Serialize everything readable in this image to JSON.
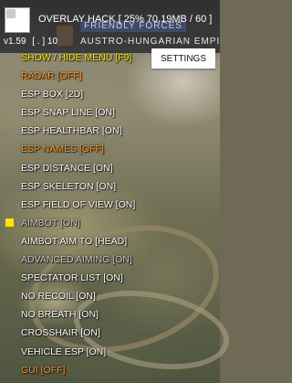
{
  "overlay": {
    "title": "OVERLAY HACK [ 25% 70.19MB / 60 ]",
    "version": "v1.59",
    "version_suffix": "[ . ] 10"
  },
  "game_banner": {
    "friendly_text": "FRIENDLY FORCES",
    "faction_text": "AUSTRO-HUNGARIAN EMPI"
  },
  "settings_button": {
    "label": "SETTINGS"
  },
  "menu": {
    "items": [
      {
        "label": "SHOW / HIDE MENU [F9]",
        "color": "#ffee00"
      },
      {
        "label": "RADAR [OFF]",
        "color": "#f59a2a"
      },
      {
        "label": "ESP BOX [2D]",
        "color": "#ffffff"
      },
      {
        "label": "ESP SNAP LINE [ON]",
        "color": "#ffffff"
      },
      {
        "label": "ESP HEALTHBAR [ON]",
        "color": "#ffffff"
      },
      {
        "label": "ESP NAMES [OFF]",
        "color": "#f59a2a"
      },
      {
        "label": "ESP DISTANCE [ON]",
        "color": "#ffffff"
      },
      {
        "label": "ESP SKELETON [ON]",
        "color": "#ffffff"
      },
      {
        "label": "ESP FIELD OF VIEW [ON]",
        "color": "#ffffff"
      },
      {
        "label": "AIMBOT [ON]",
        "color": "#c9c9c9",
        "selected": true
      },
      {
        "label": "AIMBOT AIM TO [HEAD]",
        "color": "#ffffff"
      },
      {
        "label": "ADVANCED AIMING [ON]",
        "color": "#c9c9c9"
      },
      {
        "label": "SPECTATOR LIST [ON]",
        "color": "#ffffff"
      },
      {
        "label": "NO RECOIL [ON]",
        "color": "#ffffff"
      },
      {
        "label": "NO BREATH [ON]",
        "color": "#ffffff"
      },
      {
        "label": "CROSSHAIR [ON]",
        "color": "#ffffff"
      },
      {
        "label": "VEHICLE ESP [ON]",
        "color": "#ffffff"
      },
      {
        "label": "GUI [OFF]",
        "color": "#f59a2a"
      }
    ],
    "selected_marker_color": "#ffe600"
  }
}
